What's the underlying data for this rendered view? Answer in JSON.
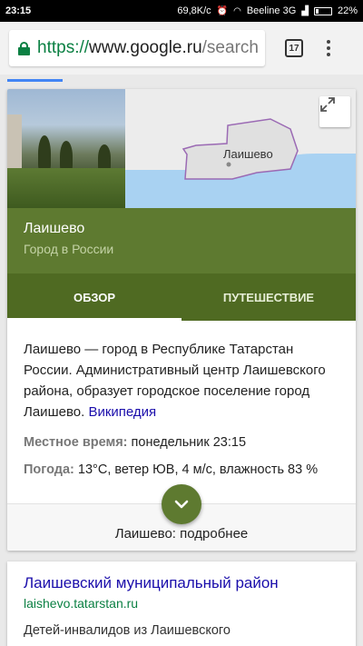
{
  "status_bar": {
    "time": "23:15",
    "speed": "69,8K/с",
    "carrier": "Beeline 3G",
    "battery": "22%"
  },
  "browser": {
    "url_scheme": "https://",
    "url_host": "www.google.ru",
    "url_path": "/search",
    "tab_count": "17"
  },
  "knowledge_panel": {
    "map_label": "Лаишево",
    "title": "Лаишево",
    "subtitle": "Город в России",
    "tabs": [
      {
        "label": "ОБЗОР"
      },
      {
        "label": "ПУТЕШЕСТВИЕ"
      }
    ],
    "description": "Лаишево — город в Республике Татарстан России. Административный центр Лаишевского района, образует городское поселение город Лаишево.",
    "source_link": "Википедия",
    "facts": [
      {
        "key": "Местное время:",
        "value": "понедельник 23:15"
      },
      {
        "key": "Погода:",
        "value": "13°C, ветер ЮВ, 4 м/с, влажность 83 %"
      }
    ],
    "more_label": "Лаишево: подробнее"
  },
  "result": {
    "title": "Лаишевский муниципальный район",
    "url": "laishevo.tatarstan.ru",
    "snippet": "Детей-инвалидов из Лаишевского"
  },
  "colors": {
    "panel_green": "#5e7a30",
    "tab_green": "#4f6a22",
    "link_blue": "#1a0dab",
    "url_green": "#0b8043"
  }
}
